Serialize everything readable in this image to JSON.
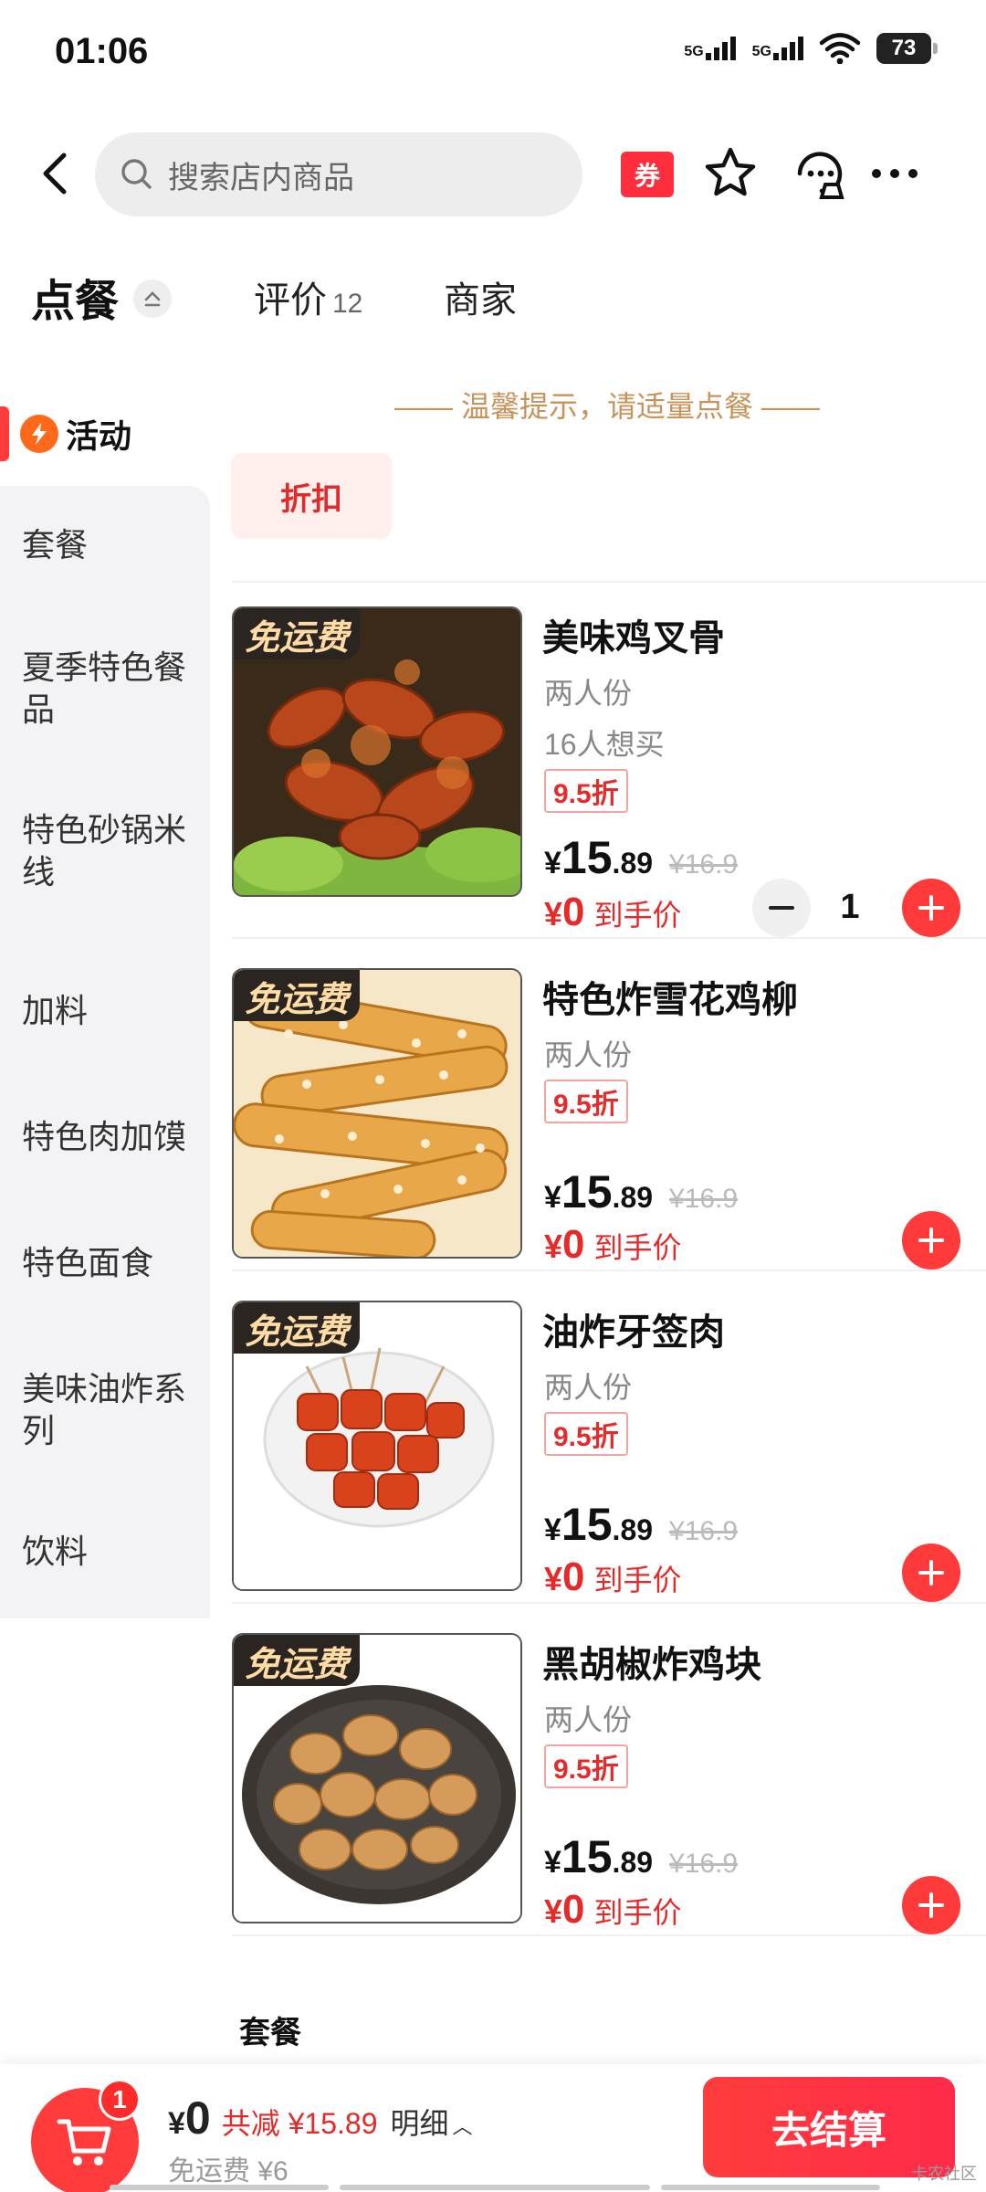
{
  "status": {
    "time": "01:06",
    "signal1": "5G",
    "signal2": "5G",
    "battery": "73"
  },
  "header": {
    "search_placeholder": "搜索店内商品",
    "coupon": "券"
  },
  "tabs": {
    "order": "点餐",
    "review": "评价",
    "review_count": "12",
    "merchant": "商家"
  },
  "sidebar": {
    "active": "活动",
    "items": [
      "套餐",
      "夏季特色餐品",
      "特色砂锅米线",
      "加料",
      "特色肉加馍",
      "特色面食",
      "美味油炸系列",
      "饮料"
    ]
  },
  "notice": "—— 温馨提示，请适量点餐 ——",
  "discount_tag": "折扣",
  "products": [
    {
      "badge": "免运费",
      "name": "美味鸡叉骨",
      "serve": "两人份",
      "want": "16人想买",
      "discount": "9.5折",
      "yen": "¥",
      "price_int": "15",
      "price_dec": ".89",
      "orig": "¥16.9",
      "final_yen": "¥",
      "final": "0",
      "final_label": "到手价",
      "qty": "1"
    },
    {
      "badge": "免运费",
      "name": "特色炸雪花鸡柳",
      "serve": "两人份",
      "discount": "9.5折",
      "yen": "¥",
      "price_int": "15",
      "price_dec": ".89",
      "orig": "¥16.9",
      "final_yen": "¥",
      "final": "0",
      "final_label": "到手价"
    },
    {
      "badge": "免运费",
      "name": "油炸牙签肉",
      "serve": "两人份",
      "discount": "9.5折",
      "yen": "¥",
      "price_int": "15",
      "price_dec": ".89",
      "orig": "¥16.9",
      "final_yen": "¥",
      "final": "0",
      "final_label": "到手价"
    },
    {
      "badge": "免运费",
      "name": "黑胡椒炸鸡块",
      "serve": "两人份",
      "discount": "9.5折",
      "yen": "¥",
      "price_int": "15",
      "price_dec": ".89",
      "orig": "¥16.9",
      "final_yen": "¥",
      "final": "0",
      "final_label": "到手价"
    }
  ],
  "section_title": "套餐",
  "cart": {
    "count": "1",
    "yen": "¥",
    "total": "0",
    "saved": "共减 ¥15.89",
    "detail": "明细",
    "delivery": "免运费 ¥6",
    "checkout": "去结算",
    "watermark": "卡农社区"
  },
  "colors": {
    "accent": "#ff3b3b",
    "notice": "#c8935a",
    "badge_bg": "#2a2520",
    "badge_text": "#ffdca6"
  }
}
